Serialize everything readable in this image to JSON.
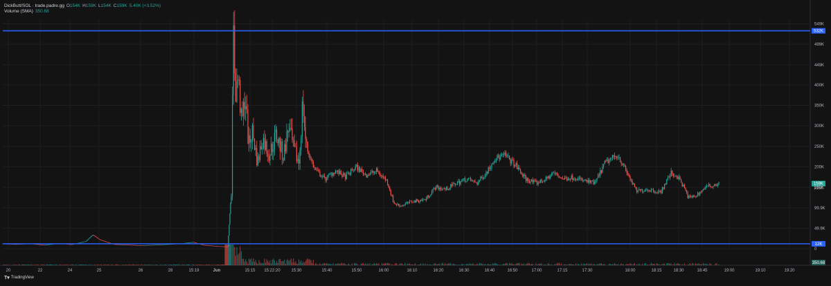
{
  "legend": {
    "symbol": "DickButt/SOL · trade.padre.gg",
    "o_key": "O",
    "o_val": "154K",
    "h_key": "H",
    "h_val": "159K",
    "l_key": "L",
    "l_val": "154K",
    "c_key": "C",
    "c_val": "159K",
    "change": "5.40K (+3.52%)",
    "volume_label": "Volume (SMA)",
    "volume_val": "350.68"
  },
  "colors": {
    "background": "#131313",
    "up": "#26a69a",
    "down": "#ef5350",
    "hline": "#2962ff",
    "text": "#b2b5be"
  },
  "chart_data": {
    "type": "line",
    "y_scale": "linear",
    "ylim": [
      0,
      560000
    ],
    "grid": true,
    "y_ticks": [
      {
        "v": 549000,
        "label": "549K"
      },
      {
        "v": 499000,
        "label": "499K"
      },
      {
        "v": 449000,
        "label": "449K"
      },
      {
        "v": 400000,
        "label": "400K"
      },
      {
        "v": 350000,
        "label": "350K"
      },
      {
        "v": 300000,
        "label": "300K"
      },
      {
        "v": 250000,
        "label": "250K"
      },
      {
        "v": 200000,
        "label": "200K"
      },
      {
        "v": 150000,
        "label": "150K"
      },
      {
        "v": 99900,
        "label": "99.9K"
      },
      {
        "v": 49900,
        "label": "49.9K"
      },
      {
        "v": 0,
        "label": "0"
      }
    ],
    "x_ticks": [
      "20",
      "22",
      "24",
      "25",
      "26",
      "28",
      "15:19",
      "Jun",
      "15:15",
      "15:22:20",
      "15:30",
      "15:40",
      "15:50",
      "16:00",
      "16:10",
      "16:20",
      "16:30",
      "16:40",
      "16:50",
      "17:00",
      "17:15",
      "17:30",
      "18:00",
      "18:15",
      "18:30",
      "18:45",
      "19:00",
      "19:10",
      "19:20"
    ],
    "horizontal_lines": [
      {
        "v": 532000,
        "label": "532K"
      },
      {
        "v": 12000,
        "label": "12K"
      }
    ],
    "last_price": {
      "v": 159000,
      "label": "159K"
    },
    "second_price": {
      "v": 155000,
      "label": "155K"
    },
    "volume_last_label": "350.68",
    "series": [
      {
        "values": [
          [
            0,
            12000
          ],
          [
            20,
            11000
          ],
          [
            40,
            12500
          ],
          [
            60,
            9000
          ],
          [
            80,
            13000
          ],
          [
            100,
            10500
          ],
          [
            120,
            18000
          ],
          [
            130,
            34000
          ],
          [
            140,
            22000
          ],
          [
            160,
            11000
          ],
          [
            200,
            8000
          ],
          [
            230,
            10000
          ],
          [
            260,
            13000
          ],
          [
            275,
            16000
          ],
          [
            290,
            9000
          ],
          [
            310,
            6000
          ],
          [
            325,
            5000
          ],
          [
            330,
            140000
          ],
          [
            333,
            532000
          ],
          [
            336,
            380000
          ],
          [
            340,
            420000
          ],
          [
            345,
            300000
          ],
          [
            350,
            380000
          ],
          [
            355,
            250000
          ],
          [
            360,
            290000
          ],
          [
            368,
            210000
          ],
          [
            375,
            270000
          ],
          [
            385,
            230000
          ],
          [
            395,
            280000
          ],
          [
            405,
            225000
          ],
          [
            413,
            300000
          ],
          [
            420,
            240000
          ],
          [
            428,
            210000
          ],
          [
            433,
            360000
          ],
          [
            438,
            250000
          ],
          [
            450,
            195000
          ],
          [
            465,
            170000
          ],
          [
            480,
            190000
          ],
          [
            495,
            175000
          ],
          [
            510,
            200000
          ],
          [
            525,
            180000
          ],
          [
            540,
            190000
          ],
          [
            555,
            165000
          ],
          [
            565,
            110000
          ],
          [
            575,
            105000
          ],
          [
            590,
            115000
          ],
          [
            610,
            120000
          ],
          [
            625,
            150000
          ],
          [
            640,
            145000
          ],
          [
            655,
            160000
          ],
          [
            670,
            170000
          ],
          [
            685,
            160000
          ],
          [
            700,
            190000
          ],
          [
            710,
            220000
          ],
          [
            725,
            228000
          ],
          [
            740,
            205000
          ],
          [
            755,
            170000
          ],
          [
            770,
            160000
          ],
          [
            785,
            170000
          ],
          [
            795,
            185000
          ],
          [
            810,
            170000
          ],
          [
            825,
            175000
          ],
          [
            840,
            165000
          ],
          [
            855,
            160000
          ],
          [
            870,
            210000
          ],
          [
            888,
            230000
          ],
          [
            900,
            190000
          ],
          [
            915,
            140000
          ],
          [
            930,
            145000
          ],
          [
            950,
            138000
          ],
          [
            965,
            185000
          ],
          [
            975,
            175000
          ],
          [
            985,
            145000
          ],
          [
            990,
            125000
          ],
          [
            1000,
            128000
          ],
          [
            1015,
            150000
          ],
          [
            1025,
            155000
          ],
          [
            1035,
            159000
          ]
        ]
      }
    ]
  }
}
